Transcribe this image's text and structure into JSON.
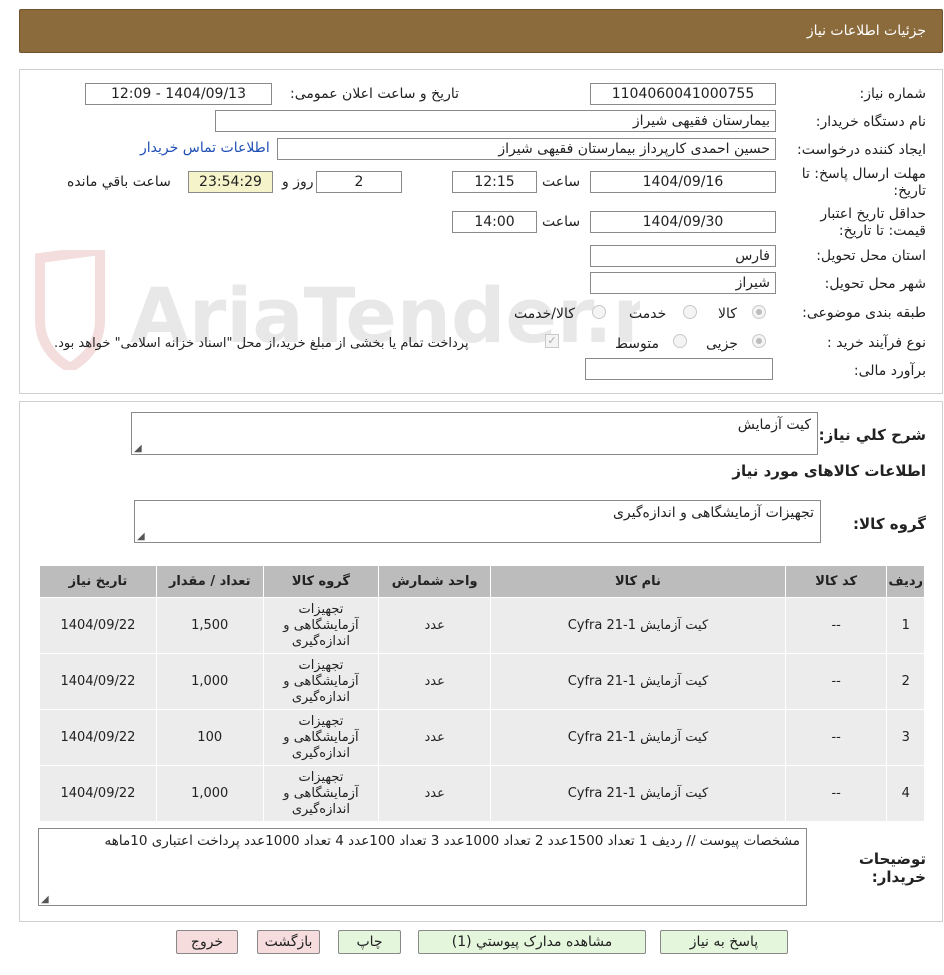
{
  "header": {
    "title": "جزئیات اطلاعات نیاز"
  },
  "form": {
    "need_number_label": "شماره نیاز:",
    "need_number": "1104060041000755",
    "announce_label": "تاریخ و ساعت اعلان عمومی:",
    "announce_value": "1404/09/13 - 12:09",
    "buyer_org_label": "نام دستگاه خریدار:",
    "buyer_org": "بیمارستان فقیهی شیراز",
    "requester_label": "ایجاد کننده درخواست:",
    "requester": "حسین احمدی کارپرداز بیمارستان فقیهی شیراز",
    "contact_link": "اطلاعات تماس خریدار",
    "deadline_label_1": "مهلت ارسال پاسخ: تا",
    "deadline_label_2": "تاریخ:",
    "deadline_date": "1404/09/16",
    "time_label": "ساعت",
    "deadline_time": "12:15",
    "days_value": "2",
    "days_label": "روز و",
    "remaining_timer": "23:54:29",
    "remaining_label": "ساعت باقي مانده",
    "validity_label_1": "حداقل تاريخ اعتبار",
    "validity_label_2": "قیمت: تا تاريخ:",
    "validity_date": "1404/09/30",
    "validity_time_label": "ساعت",
    "validity_time": "14:00",
    "province_label": "استان محل تحویل:",
    "province": "فارس",
    "city_label": "شهر محل تحویل:",
    "city": "شیراز",
    "category_label": "طبقه بندی موضوعی:",
    "category_options": [
      "کالا",
      "خدمت",
      "کالا/خدمت"
    ],
    "process_label": "نوع فرآیند خرید :",
    "process_options": [
      "جزیی",
      "متوسط"
    ],
    "payment_note": "پرداخت تمام یا بخشی از مبلغ خرید،از محل \"اسناد خزانه اسلامی\" خواهد بود.",
    "budget_label": "برآورد مالی:",
    "budget_value": ""
  },
  "summary": {
    "label": "شرح کلي نیاز:",
    "value": "کیت آزمایش",
    "goods_info_title": "اطلاعات کالاهای مورد نیاز",
    "goods_group_label": "گروه کالا:",
    "goods_group_value": "تجهیزات آزمایشگاهی و اندازه‌گیری"
  },
  "table": {
    "headers": [
      "ردیف",
      "کد کالا",
      "نام کالا",
      "واحد شمارش",
      "گروه کالا",
      "تعداد / مقدار",
      "تاریخ نیاز"
    ],
    "rows": [
      {
        "row": "1",
        "code": "--",
        "name": "کیت آزمایش Cyfra 21-1",
        "unit": "عدد",
        "group": "تجهیزات آزمایشگاهی و اندازه‌گیری",
        "qty": "1,500",
        "date": "1404/09/22"
      },
      {
        "row": "2",
        "code": "--",
        "name": "کیت آزمایش Cyfra 21-1",
        "unit": "عدد",
        "group": "تجهیزات آزمایشگاهی و اندازه‌گیری",
        "qty": "1,000",
        "date": "1404/09/22"
      },
      {
        "row": "3",
        "code": "--",
        "name": "کیت آزمایش Cyfra 21-1",
        "unit": "عدد",
        "group": "تجهیزات آزمایشگاهی و اندازه‌گیری",
        "qty": "100",
        "date": "1404/09/22"
      },
      {
        "row": "4",
        "code": "--",
        "name": "کیت آزمایش Cyfra 21-1",
        "unit": "عدد",
        "group": "تجهیزات آزمایشگاهی و اندازه‌گیری",
        "qty": "1,000",
        "date": "1404/09/22"
      }
    ]
  },
  "notes": {
    "label_1": "توضیحات",
    "label_2": "خریدار:",
    "value": "مشخصات پیوست // ردیف 1 تعداد 1500عدد 2 تعداد 1000عدد 3 تعداد 100عدد 4 تعداد 1000عدد پرداخت اعتباری 10ماهه"
  },
  "buttons": {
    "reply": "پاسخ به نیاز",
    "attachments": "مشاهده مدارک پیوستي (1)",
    "print": "چاپ",
    "back": "بازگشت",
    "exit": "خروج"
  },
  "watermark": {
    "text": "AriaTender.neT"
  },
  "colors": {
    "header_bg": "#8b6a3c",
    "table_header_bg": "#bcbcbc",
    "table_cell_bg": "#ececec",
    "link": "#1f4fb4"
  }
}
